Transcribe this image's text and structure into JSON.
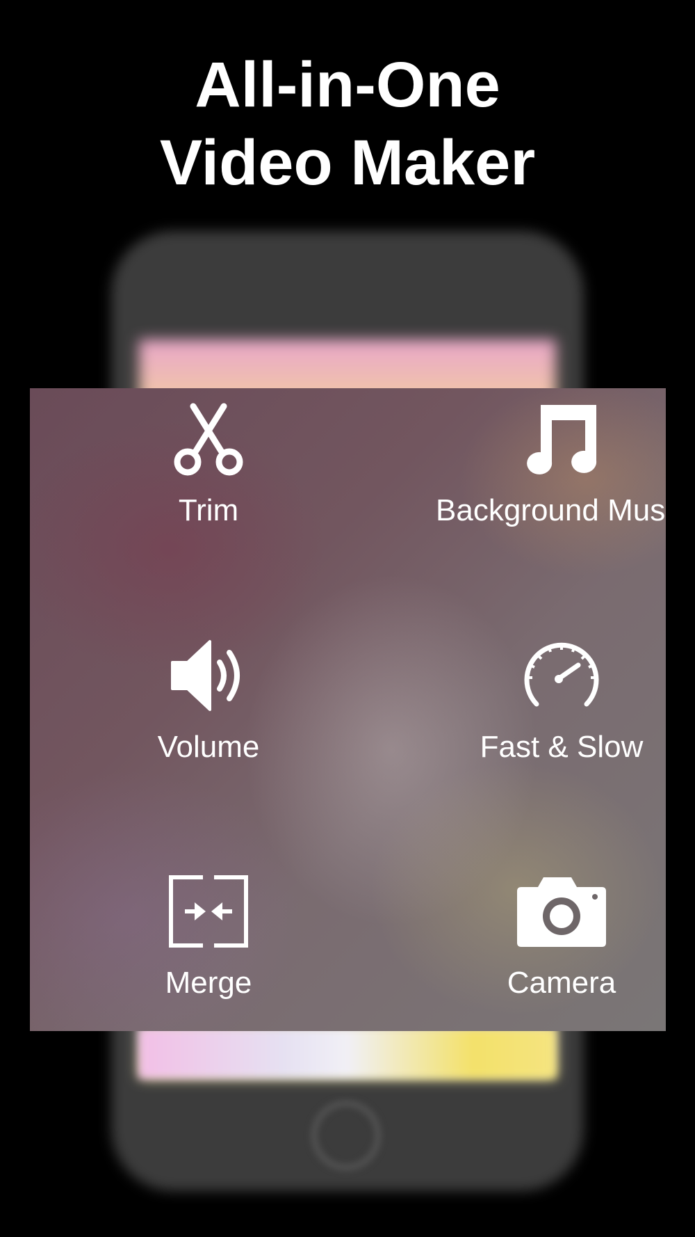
{
  "headline": {
    "line1": "All-in-One",
    "line2": "Video Maker"
  },
  "tools": [
    {
      "label": "Trim",
      "icon": "scissors-icon"
    },
    {
      "label": "Background Music",
      "icon": "music-note-icon"
    },
    {
      "label": "Volume",
      "icon": "speaker-icon"
    },
    {
      "label": "Fast & Slow",
      "icon": "speedometer-icon"
    },
    {
      "label": "Merge",
      "icon": "merge-icon"
    },
    {
      "label": "Camera",
      "icon": "camera-icon"
    }
  ],
  "colors": {
    "background": "#000000",
    "text": "#ffffff",
    "phone": "#3c3c3c"
  }
}
